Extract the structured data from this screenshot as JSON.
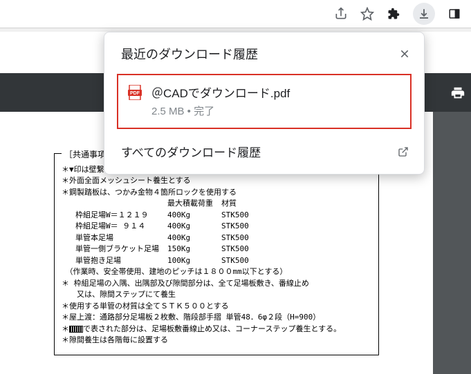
{
  "toolbar": {
    "icons": {
      "share": "share-icon",
      "star": "star-icon",
      "extensions": "puzzle-icon",
      "download": "download-icon",
      "panel": "side-panel-icon"
    }
  },
  "popup": {
    "title": "最近のダウンロード履歴",
    "close": "×",
    "item": {
      "filename": "＠CADでダウンロード.pdf",
      "meta": "2.5 MB • 完了"
    },
    "footer": {
      "label": "すべてのダウンロード履歴"
    }
  },
  "pdf": {
    "print": "print-icon"
  },
  "doc": {
    "heading": "［共通事項］",
    "l1": "＊▼印は壁繋ぎ位置を示す",
    "l2": "＊外面全面メッシュシート養生とする",
    "l3": "＊鋼製踏板は、つかみ金物４箇所ロックを使用する",
    "th1": "最大積載荷重",
    "th2": "材質",
    "r1c1": "枠組足場W＝１２１９",
    "r1c2": "400Kg",
    "r1c3": "STK500",
    "r2c1": "枠組足場W＝ ９１４",
    "r2c2": "400Kg",
    "r2c3": "STK500",
    "r3c1": "単管本足場",
    "r3c2": "400Kg",
    "r3c3": "STK500",
    "r4c1": "単管一側ブラケット足場",
    "r4c2": "150Kg",
    "r4c3": "STK500",
    "r5c1": "単管抱き足場",
    "r5c2": "100Kg",
    "r5c3": "STK500",
    "l4": "　（作業時、安全帯使用、建地のピッチは１８００mm以下とする）",
    "l5": "＊ 枠組足場の入隅、出隅部及び隙間部分は、全て足場板敷き、番線止め",
    "l6": "　　又は、隙間ステップにて養生",
    "l7": "＊使用する単管の材質は全てＳＴＫ５００とする",
    "l8": "＊屋上渡：通路部分足場板２枚敷、階段部手摺 単管48．6φ２段（H=900）",
    "l9a": "＊",
    "l9b": "で表された部分は、足場板敷番線止め又は、コーナーステップ養生とする。",
    "l10": "＊隙間養生は各階毎に設置する"
  }
}
